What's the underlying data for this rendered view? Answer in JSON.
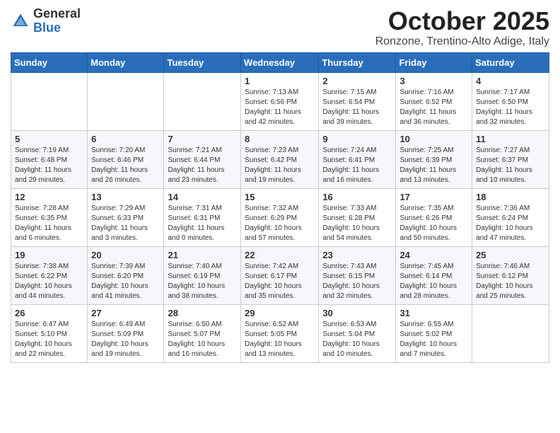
{
  "header": {
    "logo_general": "General",
    "logo_blue": "Blue",
    "month": "October 2025",
    "location": "Ronzone, Trentino-Alto Adige, Italy"
  },
  "days_of_week": [
    "Sunday",
    "Monday",
    "Tuesday",
    "Wednesday",
    "Thursday",
    "Friday",
    "Saturday"
  ],
  "weeks": [
    [
      {
        "day": "",
        "info": ""
      },
      {
        "day": "",
        "info": ""
      },
      {
        "day": "",
        "info": ""
      },
      {
        "day": "1",
        "info": "Sunrise: 7:13 AM\nSunset: 6:56 PM\nDaylight: 11 hours and 42 minutes."
      },
      {
        "day": "2",
        "info": "Sunrise: 7:15 AM\nSunset: 6:54 PM\nDaylight: 11 hours and 39 minutes."
      },
      {
        "day": "3",
        "info": "Sunrise: 7:16 AM\nSunset: 6:52 PM\nDaylight: 11 hours and 36 minutes."
      },
      {
        "day": "4",
        "info": "Sunrise: 7:17 AM\nSunset: 6:50 PM\nDaylight: 11 hours and 32 minutes."
      }
    ],
    [
      {
        "day": "5",
        "info": "Sunrise: 7:19 AM\nSunset: 6:48 PM\nDaylight: 11 hours and 29 minutes."
      },
      {
        "day": "6",
        "info": "Sunrise: 7:20 AM\nSunset: 6:46 PM\nDaylight: 11 hours and 26 minutes."
      },
      {
        "day": "7",
        "info": "Sunrise: 7:21 AM\nSunset: 6:44 PM\nDaylight: 11 hours and 23 minutes."
      },
      {
        "day": "8",
        "info": "Sunrise: 7:23 AM\nSunset: 6:42 PM\nDaylight: 11 hours and 19 minutes."
      },
      {
        "day": "9",
        "info": "Sunrise: 7:24 AM\nSunset: 6:41 PM\nDaylight: 11 hours and 16 minutes."
      },
      {
        "day": "10",
        "info": "Sunrise: 7:25 AM\nSunset: 6:39 PM\nDaylight: 11 hours and 13 minutes."
      },
      {
        "day": "11",
        "info": "Sunrise: 7:27 AM\nSunset: 6:37 PM\nDaylight: 11 hours and 10 minutes."
      }
    ],
    [
      {
        "day": "12",
        "info": "Sunrise: 7:28 AM\nSunset: 6:35 PM\nDaylight: 11 hours and 6 minutes."
      },
      {
        "day": "13",
        "info": "Sunrise: 7:29 AM\nSunset: 6:33 PM\nDaylight: 11 hours and 3 minutes."
      },
      {
        "day": "14",
        "info": "Sunrise: 7:31 AM\nSunset: 6:31 PM\nDaylight: 11 hours and 0 minutes."
      },
      {
        "day": "15",
        "info": "Sunrise: 7:32 AM\nSunset: 6:29 PM\nDaylight: 10 hours and 57 minutes."
      },
      {
        "day": "16",
        "info": "Sunrise: 7:33 AM\nSunset: 6:28 PM\nDaylight: 10 hours and 54 minutes."
      },
      {
        "day": "17",
        "info": "Sunrise: 7:35 AM\nSunset: 6:26 PM\nDaylight: 10 hours and 50 minutes."
      },
      {
        "day": "18",
        "info": "Sunrise: 7:36 AM\nSunset: 6:24 PM\nDaylight: 10 hours and 47 minutes."
      }
    ],
    [
      {
        "day": "19",
        "info": "Sunrise: 7:38 AM\nSunset: 6:22 PM\nDaylight: 10 hours and 44 minutes."
      },
      {
        "day": "20",
        "info": "Sunrise: 7:39 AM\nSunset: 6:20 PM\nDaylight: 10 hours and 41 minutes."
      },
      {
        "day": "21",
        "info": "Sunrise: 7:40 AM\nSunset: 6:19 PM\nDaylight: 10 hours and 38 minutes."
      },
      {
        "day": "22",
        "info": "Sunrise: 7:42 AM\nSunset: 6:17 PM\nDaylight: 10 hours and 35 minutes."
      },
      {
        "day": "23",
        "info": "Sunrise: 7:43 AM\nSunset: 6:15 PM\nDaylight: 10 hours and 32 minutes."
      },
      {
        "day": "24",
        "info": "Sunrise: 7:45 AM\nSunset: 6:14 PM\nDaylight: 10 hours and 28 minutes."
      },
      {
        "day": "25",
        "info": "Sunrise: 7:46 AM\nSunset: 6:12 PM\nDaylight: 10 hours and 25 minutes."
      }
    ],
    [
      {
        "day": "26",
        "info": "Sunrise: 6:47 AM\nSunset: 5:10 PM\nDaylight: 10 hours and 22 minutes."
      },
      {
        "day": "27",
        "info": "Sunrise: 6:49 AM\nSunset: 5:09 PM\nDaylight: 10 hours and 19 minutes."
      },
      {
        "day": "28",
        "info": "Sunrise: 6:50 AM\nSunset: 5:07 PM\nDaylight: 10 hours and 16 minutes."
      },
      {
        "day": "29",
        "info": "Sunrise: 6:52 AM\nSunset: 5:05 PM\nDaylight: 10 hours and 13 minutes."
      },
      {
        "day": "30",
        "info": "Sunrise: 6:53 AM\nSunset: 5:04 PM\nDaylight: 10 hours and 10 minutes."
      },
      {
        "day": "31",
        "info": "Sunrise: 6:55 AM\nSunset: 5:02 PM\nDaylight: 10 hours and 7 minutes."
      },
      {
        "day": "",
        "info": ""
      }
    ]
  ]
}
